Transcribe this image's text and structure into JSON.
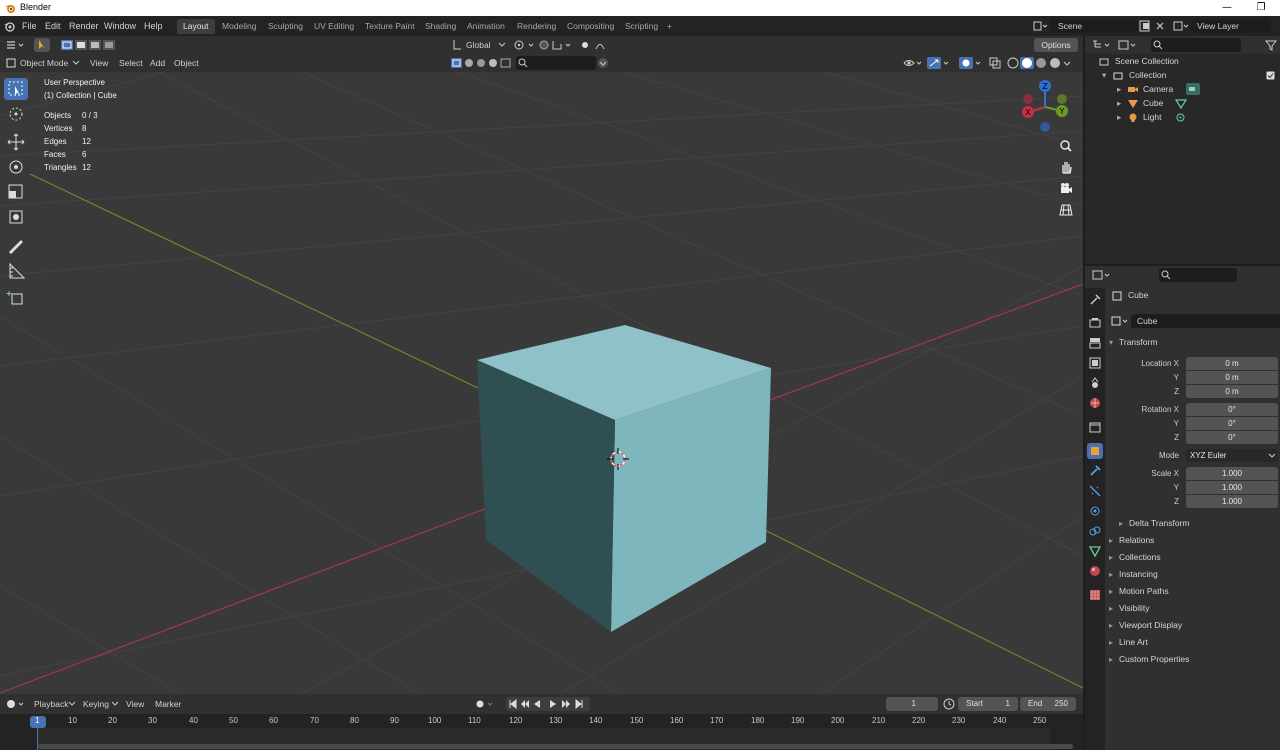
{
  "window": {
    "title": "Blender"
  },
  "menu": {
    "items": [
      "File",
      "Edit",
      "Render",
      "Window",
      "Help"
    ],
    "workspaces": [
      "Layout",
      "Modeling",
      "Sculpting",
      "UV Editing",
      "Texture Paint",
      "Shading",
      "Animation",
      "Rendering",
      "Compositing",
      "Scripting"
    ],
    "active_workspace": "Layout",
    "add_workspace": "+",
    "scene": "Scene",
    "view_layer": "View Layer"
  },
  "viewport": {
    "mode": "Object Mode",
    "menus": [
      "View",
      "Select",
      "Add",
      "Object"
    ],
    "transform_orientation": "Global",
    "options_label": "Options",
    "overlay": {
      "perspective": "User Perspective",
      "context": "(1) Collection | Cube"
    },
    "stats": [
      {
        "label": "Objects",
        "value": "0 / 3"
      },
      {
        "label": "Vertices",
        "value": "8"
      },
      {
        "label": "Edges",
        "value": "12"
      },
      {
        "label": "Faces",
        "value": "6"
      },
      {
        "label": "Triangles",
        "value": "12"
      }
    ],
    "gizmo_axes": {
      "x": "X",
      "y": "Y",
      "z": "Z"
    },
    "colors": {
      "background": "#393939",
      "cube_top": "#8ec1c8",
      "cube_right": "#7eb6bd",
      "cube_left": "#2f4f53",
      "x_axis": "#a1394a",
      "y_axis": "#6b8a2a"
    }
  },
  "outliner": {
    "root": "Scene Collection",
    "collection": "Collection",
    "objects": [
      "Camera",
      "Cube",
      "Light"
    ]
  },
  "properties": {
    "object_name": "Cube",
    "data_name": "Cube",
    "transform_header": "Transform",
    "location": {
      "label": "Location X",
      "x": "0 m",
      "y": "0 m",
      "z": "0 m"
    },
    "rotation": {
      "label": "Rotation X",
      "x": "0°",
      "y": "0°",
      "z": "0°"
    },
    "mode": {
      "label": "Mode",
      "value": "XYZ Euler"
    },
    "scale": {
      "label": "Scale X",
      "x": "1.000",
      "y": "1.000",
      "z": "1.000"
    },
    "axis_labels": {
      "y": "Y",
      "z": "Z"
    },
    "delta_transform": "Delta Transform",
    "panels": [
      "Relations",
      "Collections",
      "Instancing",
      "Motion Paths",
      "Visibility",
      "Viewport Display",
      "Line Art",
      "Custom Properties"
    ]
  },
  "timeline": {
    "menus": [
      "Playback",
      "Keying",
      "View",
      "Marker"
    ],
    "current_frame": "1",
    "start_label": "Start",
    "start": "1",
    "end_label": "End",
    "end": "250",
    "ticks": [
      "1",
      "10",
      "20",
      "30",
      "40",
      "50",
      "60",
      "70",
      "80",
      "90",
      "100",
      "110",
      "120",
      "130",
      "140",
      "150",
      "160",
      "170",
      "180",
      "190",
      "200",
      "210",
      "220",
      "230",
      "240",
      "250"
    ]
  }
}
